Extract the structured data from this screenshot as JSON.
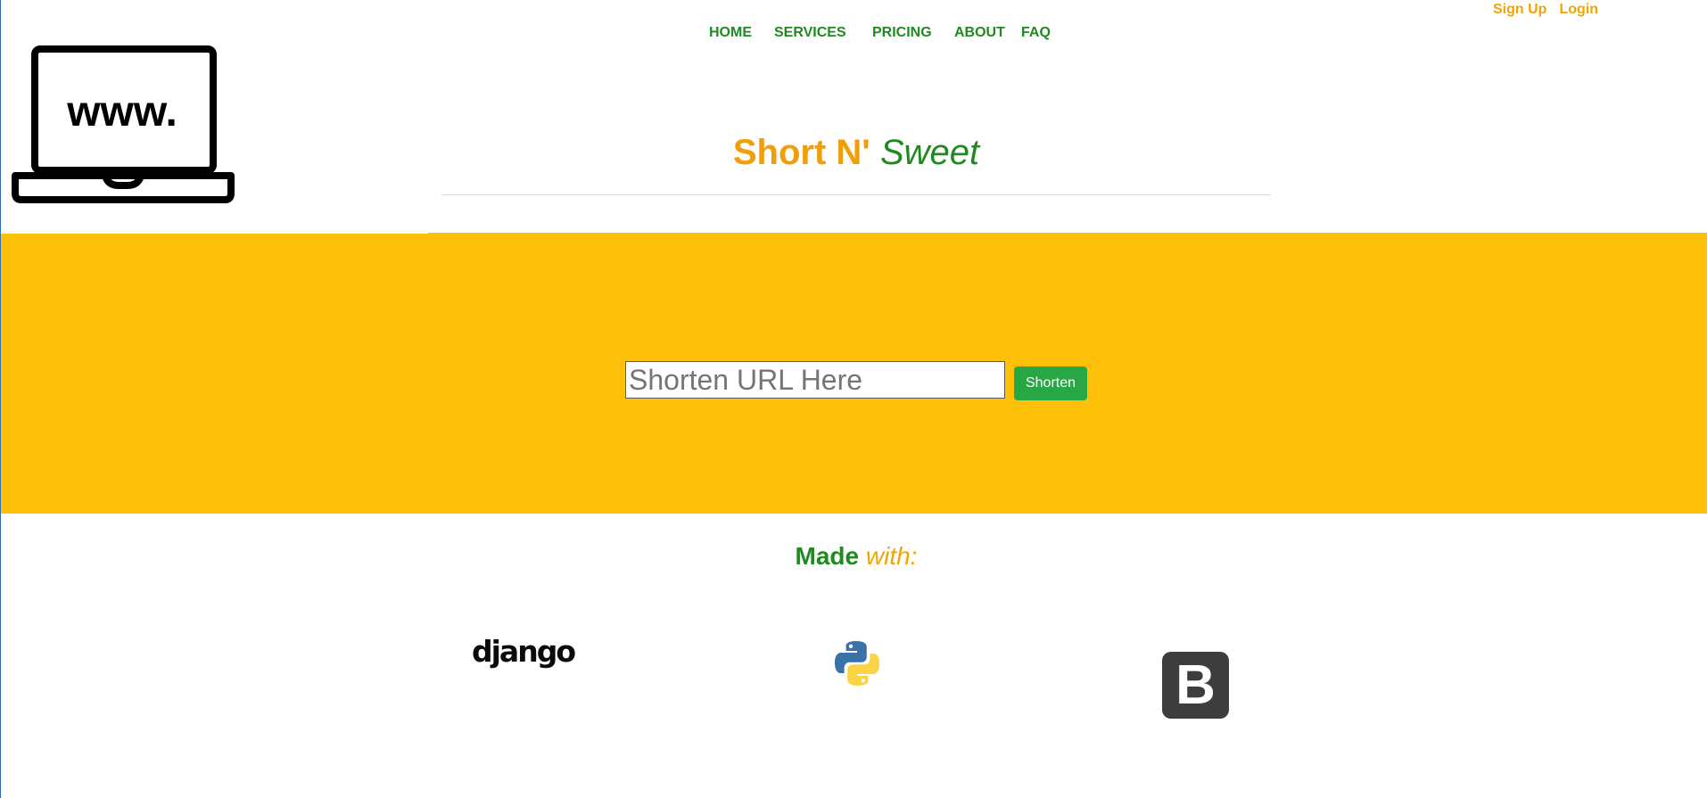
{
  "auth": {
    "signup": "Sign Up",
    "login": "Login"
  },
  "nav": {
    "home": "HOME",
    "services": "SERVICES",
    "pricing": "PRICING",
    "about": "ABOUT",
    "faq": "FAQ"
  },
  "logo": {
    "text": "www.",
    "icon": "laptop-icon"
  },
  "brand": {
    "short": "Short N'",
    "sweet": "Sweet"
  },
  "form": {
    "placeholder": "Shorten URL Here",
    "value": "",
    "button": "Shorten"
  },
  "made_with": {
    "made": "Made",
    "with": "with:",
    "django": "django",
    "bootstrap_letter": "B",
    "icons": [
      "django-logo",
      "python-icon",
      "bootstrap-icon"
    ]
  },
  "colors": {
    "hero": "#fec008",
    "green": "#1f8a1f",
    "orange": "#f0a500",
    "button": "#28a745"
  }
}
